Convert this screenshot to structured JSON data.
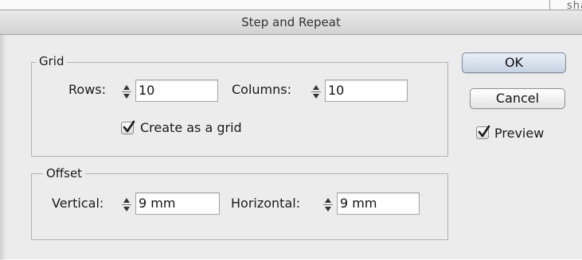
{
  "window": {
    "title": "Step and Repeat",
    "background_snippet": "sha"
  },
  "grid_group": {
    "legend": "Grid",
    "rows_label": "Rows:",
    "rows_value": "10",
    "columns_label": "Columns:",
    "columns_value": "10",
    "create_grid_label": "Create as a grid",
    "create_grid_checked": true
  },
  "offset_group": {
    "legend": "Offset",
    "vertical_label": "Vertical:",
    "vertical_value": "9 mm",
    "horizontal_label": "Horizontal:",
    "horizontal_value": "9 mm"
  },
  "buttons": {
    "ok_label": "OK",
    "cancel_label": "Cancel"
  },
  "preview": {
    "label": "Preview",
    "checked": true
  },
  "colors": {
    "dialog_bg": "#ececec",
    "ok_button": "#c6d2e2",
    "group_border": "#b2b2b2"
  },
  "icons": [
    "spinner-arrows-icon",
    "checkmark-icon"
  ]
}
